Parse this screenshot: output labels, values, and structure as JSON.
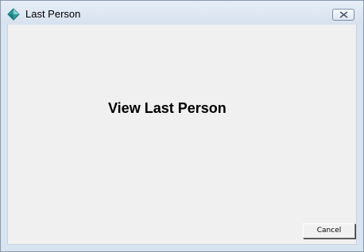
{
  "window": {
    "title": "Last Person",
    "icon": "diamond-app-icon",
    "close_icon": "close-icon"
  },
  "content": {
    "heading": "View Last Person"
  },
  "buttons": {
    "cancel_label": "Cancel"
  },
  "colors": {
    "titlebar_top": "#e7eef7",
    "titlebar_bottom": "#d7e2ef",
    "client_bg": "#f0f0f0",
    "window_border": "#8a9aab",
    "icon_teal": "#2d9c9b"
  }
}
